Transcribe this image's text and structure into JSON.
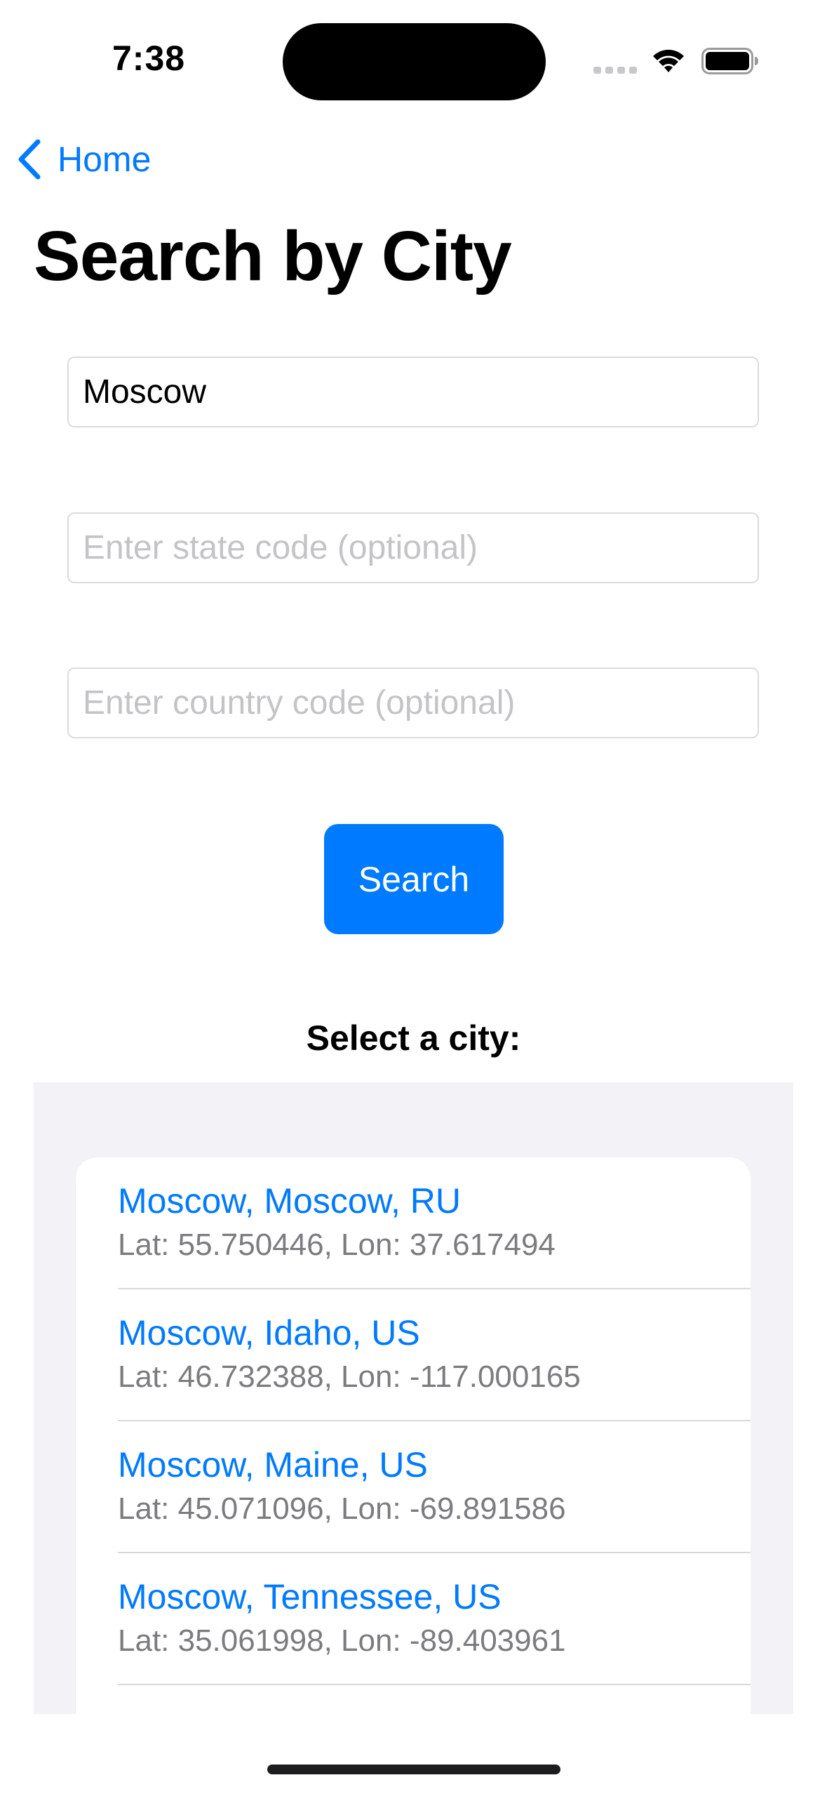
{
  "status_bar": {
    "time": "7:38"
  },
  "nav": {
    "back_label": "Home"
  },
  "page": {
    "title": "Search by City"
  },
  "form": {
    "city_value": "Moscow",
    "city_placeholder": "",
    "state_value": "",
    "state_placeholder": "Enter state code (optional)",
    "country_value": "",
    "country_placeholder": "Enter country code (optional)",
    "search_label": "Search"
  },
  "results": {
    "heading": "Select a city:",
    "items": [
      {
        "title": "Moscow, Moscow, RU",
        "coords": "Lat: 55.750446, Lon: 37.617494"
      },
      {
        "title": "Moscow, Idaho, US",
        "coords": "Lat: 46.732388, Lon: -117.000165"
      },
      {
        "title": "Moscow, Maine, US",
        "coords": "Lat: 45.071096, Lon: -69.891586"
      },
      {
        "title": "Moscow, Tennessee, US",
        "coords": "Lat: 35.061998, Lon: -89.403961"
      }
    ]
  },
  "colors": {
    "accent": "#007AFF",
    "list_background": "#f2f2f7",
    "secondary_text": "#7c7c80"
  },
  "icons": {
    "back": "chevron-left-icon",
    "wifi": "wifi-icon",
    "battery": "battery-icon",
    "signal": "cellular-signal-icon"
  }
}
